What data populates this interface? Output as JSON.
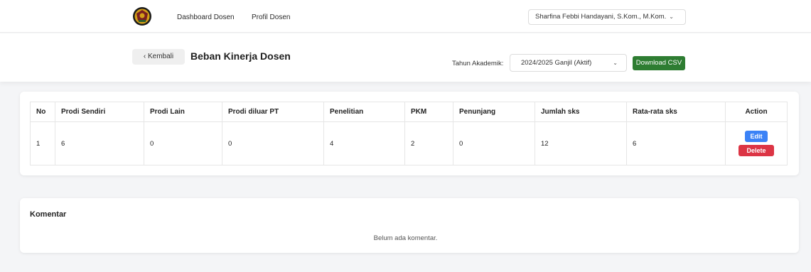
{
  "nav": {
    "links": [
      "Dashboard Dosen",
      "Profil Dosen"
    ],
    "user_name": "Sharfina Febbi Handayani, S.Kom., M.Kom."
  },
  "header": {
    "back_label": "Kembali",
    "title": "Beban Kinerja Dosen",
    "tahun_label": "Tahun Akademik:",
    "tahun_value": "2024/2025 Ganjil (Aktif)",
    "csv_label": "Download CSV"
  },
  "table": {
    "columns": [
      "No",
      "Prodi Sendiri",
      "Prodi Lain",
      "Prodi diluar PT",
      "Penelitian",
      "PKM",
      "Penunjang",
      "Jumlah sks",
      "Rata-rata sks",
      "Action"
    ],
    "rows": [
      {
        "cells": [
          "1",
          "6",
          "0",
          "0",
          "4",
          "2",
          "0",
          "12",
          "6"
        ],
        "edit": "Edit",
        "delete": "Delete"
      }
    ]
  },
  "komentar": {
    "title": "Komentar",
    "empty_text": "Belum ada komentar."
  },
  "colors": {
    "primary": "#3b82f6",
    "danger": "#dc3545",
    "success": "#2e7d32"
  },
  "icons": {
    "logo": "university-logo",
    "back": "chevron-left-icon",
    "dropdown": "chevron-down-icon"
  }
}
